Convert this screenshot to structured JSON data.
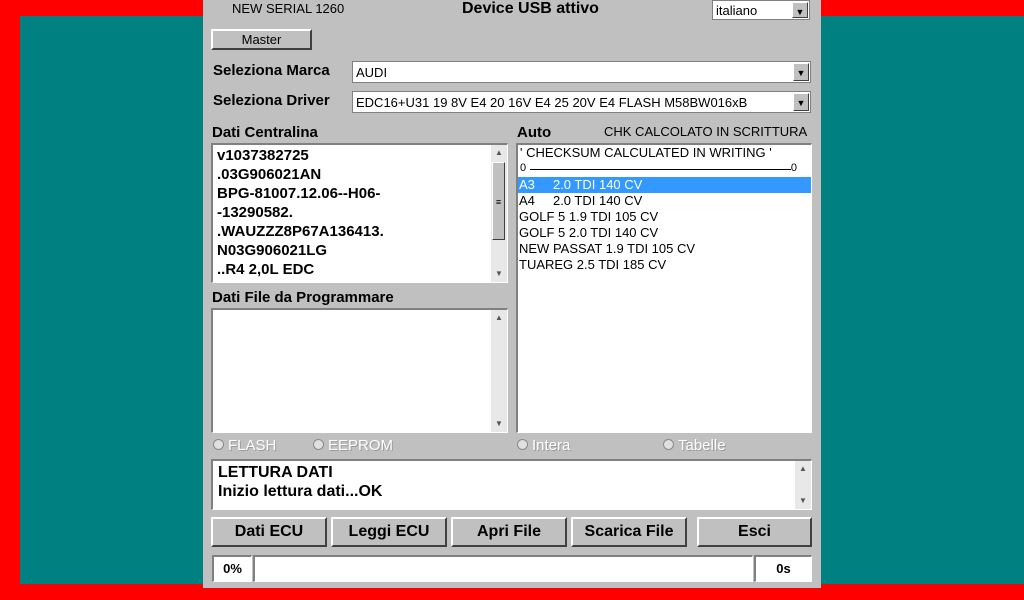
{
  "window": {
    "serial": "NEW SERIAL 1260",
    "title": "Device USB attivo",
    "language": "italiano"
  },
  "buttons": {
    "master": "Master",
    "dati_ecu": "Dati ECU",
    "leggi_ecu": "Leggi ECU",
    "apri_file": "Apri File",
    "scarica_file": "Scarica File",
    "esci": "Esci"
  },
  "marca": {
    "label": "Seleziona Marca",
    "value": "AUDI"
  },
  "driver": {
    "label": "Seleziona Driver",
    "value": "EDC16+U31 19 8V E4  20 16V E4  25 20V E4 FLASH M58BW016xB"
  },
  "centralina": {
    "label": "Dati Centralina",
    "lines": [
      "v1037382725",
      ".03G906021AN",
      "BPG-81007.12.06--H06-",
      "-13290582.",
      ".WAUZZZ8P67A136413.",
      "N03G906021LG",
      "..R4 2,0L EDC"
    ]
  },
  "file_prog": {
    "label": "Dati File da Programmare"
  },
  "auto": {
    "label": "Auto",
    "chk": "CHK CALCOLATO IN SCRITTURA",
    "header": "' CHECKSUM CALCULATED IN WRITING '",
    "range_start": "0",
    "range_end": "0",
    "items": [
      "A3     2.0 TDI 140 CV",
      "A4     2.0 TDI 140 CV",
      "GOLF 5 1.9 TDI 105 CV",
      "GOLF 5 2.0 TDI 140 CV",
      "NEW PASSAT 1.9 TDI 105 CV",
      "TUAREG 2.5 TDI 185 CV"
    ],
    "selected_index": 0
  },
  "radios": {
    "flash": "FLASH",
    "eeprom": "EEPROM",
    "intera": "Intera",
    "tabelle": "Tabelle"
  },
  "log": {
    "lines": [
      "LETTURA DATI",
      "Inizio lettura dati...OK"
    ]
  },
  "status": {
    "percent": "0%",
    "progress": 0,
    "time": "0s"
  }
}
